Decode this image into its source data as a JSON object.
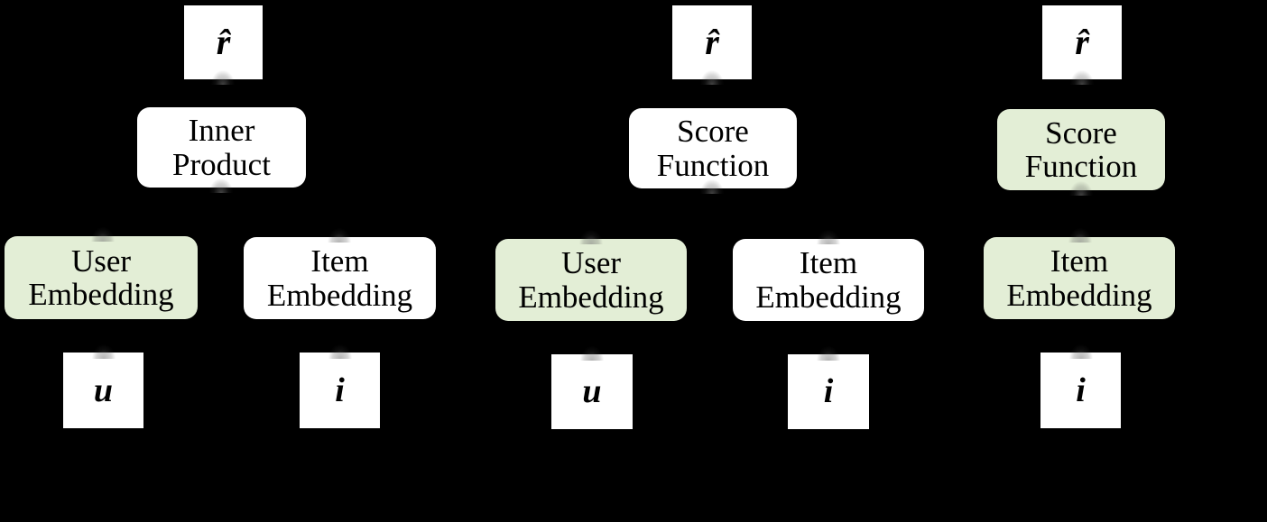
{
  "figure": {
    "type": "diagram",
    "background_color": "#000000",
    "accent_color": "#e3eed6",
    "box_white": "#ffffff",
    "text_color": "#000000",
    "description": "Three recommender-model architecture variants: inner-product matrix factorization, score-function with user and item embeddings, and score-function with item embedding only."
  },
  "panels": [
    {
      "id": "panel-inner-product",
      "output": {
        "label": "r̂"
      },
      "operator": {
        "label": "Inner\nProduct",
        "fill": "#ffffff"
      },
      "encoders": [
        {
          "label": "User\nEmbedding",
          "fill": "#e3eed6"
        },
        {
          "label": "Item\nEmbedding",
          "fill": "#ffffff"
        }
      ],
      "inputs": [
        {
          "label": "u"
        },
        {
          "label": "i"
        }
      ]
    },
    {
      "id": "panel-score-function-two-tower",
      "output": {
        "label": "r̂"
      },
      "operator": {
        "label": "Score\nFunction",
        "fill": "#ffffff"
      },
      "encoders": [
        {
          "label": "User\nEmbedding",
          "fill": "#e3eed6"
        },
        {
          "label": "Item\nEmbedding",
          "fill": "#ffffff"
        }
      ],
      "inputs": [
        {
          "label": "u"
        },
        {
          "label": "i"
        }
      ]
    },
    {
      "id": "panel-score-function-item-only",
      "output": {
        "label": "r̂"
      },
      "operator": {
        "label": "Score\nFunction",
        "fill": "#e3eed6"
      },
      "encoders": [
        {
          "label": "Item\nEmbedding",
          "fill": "#e3eed6"
        }
      ],
      "inputs": [
        {
          "label": "i"
        }
      ]
    }
  ]
}
